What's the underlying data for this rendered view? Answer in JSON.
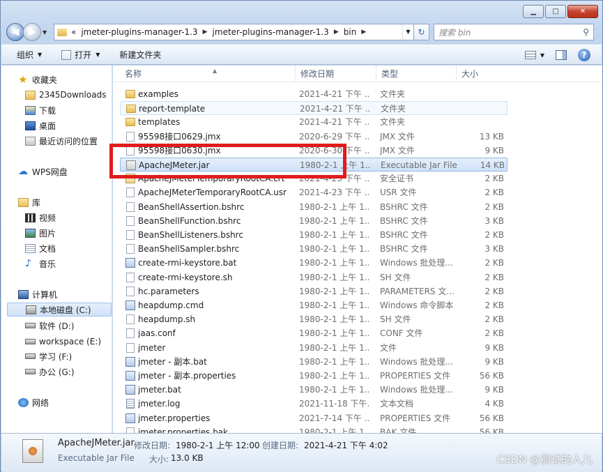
{
  "titlebar": {
    "min_label": "▁",
    "max_label": "□",
    "close_label": "✕"
  },
  "address": {
    "prefix": "«",
    "crumbs": [
      "jmeter-plugins-manager-1.3",
      "jmeter-plugins-manager-1.3",
      "bin"
    ],
    "search_placeholder": "搜索 bin"
  },
  "toolbar": {
    "organize": "组织",
    "open": "打开",
    "new_folder": "新建文件夹"
  },
  "sidebar": {
    "items": [
      {
        "label": "收藏夹",
        "icon": "star-icon"
      },
      {
        "label": "2345Downloads",
        "icon": "folder-icon"
      },
      {
        "label": "下载",
        "icon": "download-folder-icon"
      },
      {
        "label": "桌面",
        "icon": "desktop-icon"
      },
      {
        "label": "最近访问的位置",
        "icon": "recent-places-icon"
      },
      {
        "label": "WPS网盘",
        "icon": "cloud-icon"
      },
      {
        "label": "库",
        "icon": "library-icon"
      },
      {
        "label": "视频",
        "icon": "video-icon"
      },
      {
        "label": "图片",
        "icon": "picture-icon"
      },
      {
        "label": "文档",
        "icon": "document-icon"
      },
      {
        "label": "音乐",
        "icon": "music-icon"
      },
      {
        "label": "计算机",
        "icon": "computer-icon"
      },
      {
        "label": "本地磁盘 (C:)",
        "icon": "drive-icon"
      },
      {
        "label": "软件 (D:)",
        "icon": "drive-icon"
      },
      {
        "label": "workspace (E:)",
        "icon": "drive-icon"
      },
      {
        "label": "学习 (F:)",
        "icon": "drive-icon"
      },
      {
        "label": "办公 (G:)",
        "icon": "drive-icon"
      },
      {
        "label": "网络",
        "icon": "network-icon"
      }
    ]
  },
  "columns": {
    "name": "名称",
    "date": "修改日期",
    "type": "类型",
    "size": "大小"
  },
  "files": [
    {
      "name": "examples",
      "date": "2021-4-21 下午 ...",
      "type": "文件夹",
      "size": "",
      "icon": "folder-icon"
    },
    {
      "name": "report-template",
      "date": "2021-4-21 下午 ...",
      "type": "文件夹",
      "size": "",
      "icon": "folder-icon"
    },
    {
      "name": "templates",
      "date": "2021-4-21 下午 ...",
      "type": "文件夹",
      "size": "",
      "icon": "folder-icon"
    },
    {
      "name": "95598接口0629.jmx",
      "date": "2020-6-29 下午 ...",
      "type": "JMX 文件",
      "size": "13 KB",
      "icon": "file-icon"
    },
    {
      "name": "95598接口0630.jmx",
      "date": "2020-6-30 下午 ...",
      "type": "JMX 文件",
      "size": "9 KB",
      "icon": "file-icon"
    },
    {
      "name": "ApacheJMeter.jar",
      "date": "1980-2-1 上午 1...",
      "type": "Executable Jar File",
      "size": "14 KB",
      "icon": "jar-icon"
    },
    {
      "name": "ApacheJMeterTemporaryRootCA.crt",
      "date": "2021-4-23 下午 ...",
      "type": "安全证书",
      "size": "2 KB",
      "icon": "certificate-icon"
    },
    {
      "name": "ApacheJMeterTemporaryRootCA.usr",
      "date": "2021-4-23 下午 ...",
      "type": "USR 文件",
      "size": "2 KB",
      "icon": "file-icon"
    },
    {
      "name": "BeanShellAssertion.bshrc",
      "date": "1980-2-1 上午 1...",
      "type": "BSHRC 文件",
      "size": "2 KB",
      "icon": "file-icon"
    },
    {
      "name": "BeanShellFunction.bshrc",
      "date": "1980-2-1 上午 1...",
      "type": "BSHRC 文件",
      "size": "3 KB",
      "icon": "file-icon"
    },
    {
      "name": "BeanShellListeners.bshrc",
      "date": "1980-2-1 上午 1...",
      "type": "BSHRC 文件",
      "size": "2 KB",
      "icon": "file-icon"
    },
    {
      "name": "BeanShellSampler.bshrc",
      "date": "1980-2-1 上午 1...",
      "type": "BSHRC 文件",
      "size": "3 KB",
      "icon": "file-icon"
    },
    {
      "name": "create-rmi-keystore.bat",
      "date": "1980-2-1 上午 1...",
      "type": "Windows 批处理...",
      "size": "2 KB",
      "icon": "script-icon"
    },
    {
      "name": "create-rmi-keystore.sh",
      "date": "1980-2-1 上午 1...",
      "type": "SH 文件",
      "size": "2 KB",
      "icon": "file-icon"
    },
    {
      "name": "hc.parameters",
      "date": "1980-2-1 上午 1...",
      "type": "PARAMETERS 文...",
      "size": "2 KB",
      "icon": "file-icon"
    },
    {
      "name": "heapdump.cmd",
      "date": "1980-2-1 上午 1...",
      "type": "Windows 命令脚本",
      "size": "2 KB",
      "icon": "script-icon"
    },
    {
      "name": "heapdump.sh",
      "date": "1980-2-1 上午 1...",
      "type": "SH 文件",
      "size": "2 KB",
      "icon": "file-icon"
    },
    {
      "name": "jaas.conf",
      "date": "1980-2-1 上午 1...",
      "type": "CONF 文件",
      "size": "2 KB",
      "icon": "file-icon"
    },
    {
      "name": "jmeter",
      "date": "1980-2-1 上午 1...",
      "type": "文件",
      "size": "9 KB",
      "icon": "file-icon"
    },
    {
      "name": "jmeter - 副本.bat",
      "date": "1980-2-1 上午 1...",
      "type": "Windows 批处理...",
      "size": "9 KB",
      "icon": "script-icon"
    },
    {
      "name": "jmeter - 副本.properties",
      "date": "1980-2-1 上午 1...",
      "type": "PROPERTIES 文件",
      "size": "56 KB",
      "icon": "script-icon"
    },
    {
      "name": "jmeter.bat",
      "date": "1980-2-1 上午 1...",
      "type": "Windows 批处理...",
      "size": "9 KB",
      "icon": "script-icon"
    },
    {
      "name": "jmeter.log",
      "date": "2021-11-18 下午...",
      "type": "文本文档",
      "size": "4 KB",
      "icon": "text-file-icon"
    },
    {
      "name": "jmeter.properties",
      "date": "2021-7-14 下午 ...",
      "type": "PROPERTIES 文件",
      "size": "56 KB",
      "icon": "script-icon"
    },
    {
      "name": "jmeter.properties.bak",
      "date": "1980-2-1 上午 1...",
      "type": "BAK 文件",
      "size": "56 KB",
      "icon": "file-icon"
    }
  ],
  "details": {
    "name": "ApacheJMeter.jar",
    "type": "Executable Jar File",
    "modified_label": "修改日期:",
    "modified_value": "1980-2-1 上午 12:00",
    "created_label": "创建日期:",
    "created_value": "2021-4-21 下午 4:02",
    "size_label": "大小:",
    "size_value": "13.0 KB"
  },
  "watermark": "CSDN @测试的人儿",
  "colors": {
    "highlight_border": "#e11b1b",
    "selection": "#cfe2f8"
  }
}
